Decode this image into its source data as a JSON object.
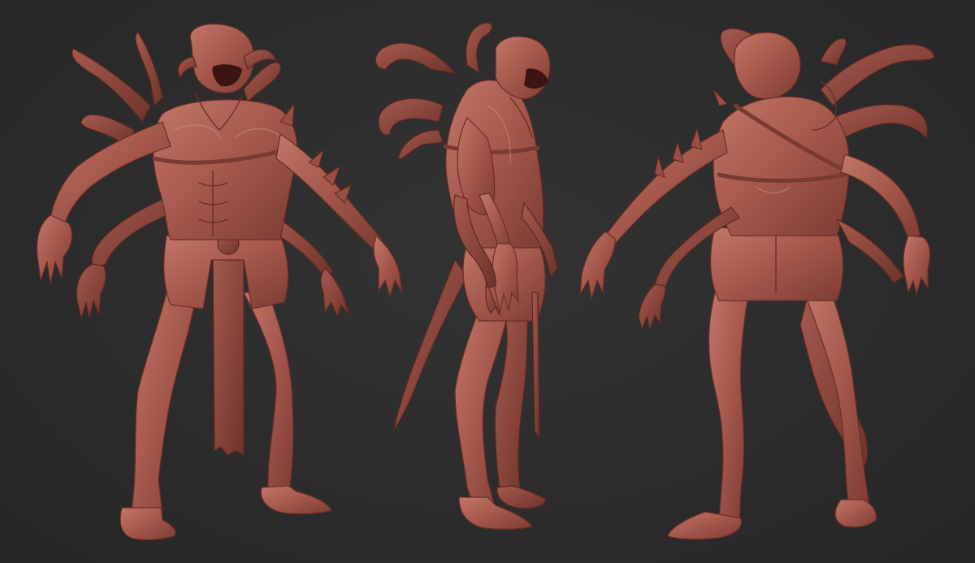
{
  "scene": {
    "background_color": "#2b2b2b",
    "clay_color": "#a4574b",
    "views": [
      "front",
      "side",
      "back"
    ]
  }
}
